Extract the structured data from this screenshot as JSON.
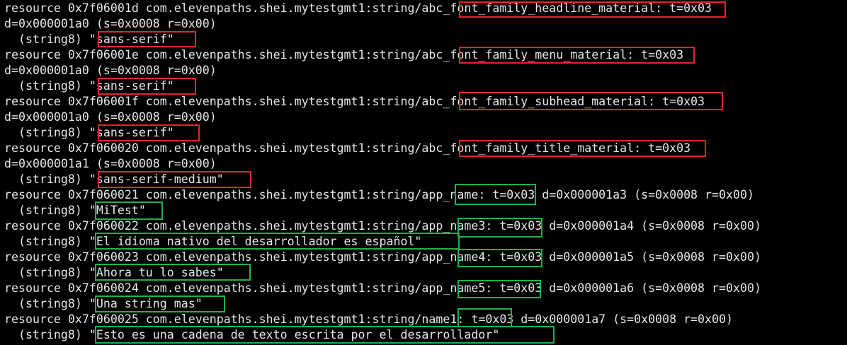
{
  "colors": {
    "background": "#000000",
    "text": "#e6e6e6",
    "highlight_red": "#e3262b",
    "highlight_green": "#22b14c"
  },
  "terminal": {
    "lines": [
      "resource 0x7f06001d com.elevenpaths.shei.mytestgmt1:string/abc_font_family_headline_material: t=0x03",
      "d=0x000001a0 (s=0x0008 r=0x00)",
      "  (string8) \"sans-serif\"",
      "resource 0x7f06001e com.elevenpaths.shei.mytestgmt1:string/abc_font_family_menu_material: t=0x03",
      "d=0x000001a0 (s=0x0008 r=0x00)",
      "  (string8) \"sans-serif\"",
      "resource 0x7f06001f com.elevenpaths.shei.mytestgmt1:string/abc_font_family_subhead_material: t=0x03",
      "d=0x000001a0 (s=0x0008 r=0x00)",
      "  (string8) \"sans-serif\"",
      "resource 0x7f060020 com.elevenpaths.shei.mytestgmt1:string/abc_font_family_title_material: t=0x03",
      "d=0x000001a1 (s=0x0008 r=0x00)",
      "  (string8) \"sans-serif-medium\"",
      "resource 0x7f060021 com.elevenpaths.shei.mytestgmt1:string/app_name: t=0x03 d=0x000001a3 (s=0x0008 r=0x00)",
      "  (string8) \"MiTest\"",
      "resource 0x7f060022 com.elevenpaths.shei.mytestgmt1:string/app_name3: t=0x03 d=0x000001a4 (s=0x0008 r=0x00)",
      "  (string8) \"El idioma nativo del desarrollador es español\"",
      "resource 0x7f060023 com.elevenpaths.shei.mytestgmt1:string/app_name4: t=0x03 d=0x000001a5 (s=0x0008 r=0x00)",
      "  (string8) \"Ahora tu lo sabes\"",
      "resource 0x7f060024 com.elevenpaths.shei.mytestgmt1:string/app_name5: t=0x03 d=0x000001a6 (s=0x0008 r=0x00)",
      "  (string8) \"Una string mas\"",
      "resource 0x7f060025 com.elevenpaths.shei.mytestgmt1:string/name1: t=0x03 d=0x000001a7 (s=0x0008 r=0x00)",
      "  (string8) \"Esto es una cadena de texto escrita por el desarrollador\""
    ]
  }
}
